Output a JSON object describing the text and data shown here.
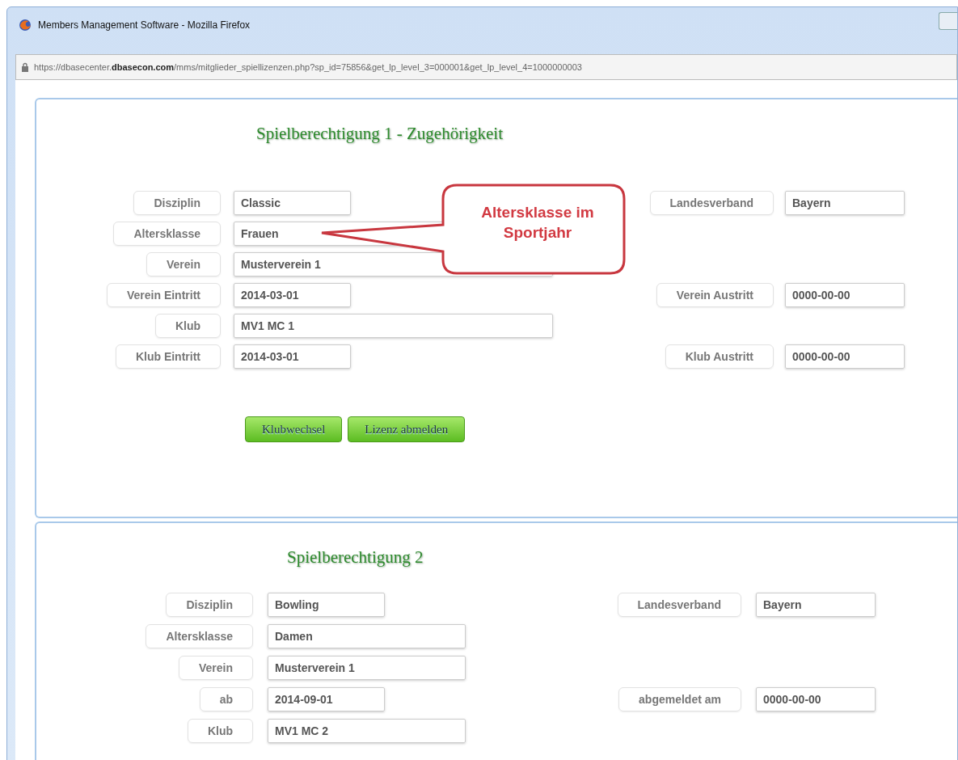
{
  "window": {
    "title": "Members Management Software - Mozilla Firefox"
  },
  "address_bar": {
    "url": "https://dbasecenter.**dbasecon.com**/mms/mitglieder_spiellizenzen.php?sp_id=75856&get_lp_level_3=000001&get_lp_level_4=1000000003"
  },
  "sections": [
    {
      "title": "Spielberechtigung 1 - Zugehörigkeit",
      "rows": [
        {
          "label": "Disziplin",
          "value": "Classic",
          "right": {
            "label": "Landesverband",
            "value": "Bayern"
          }
        },
        {
          "label": "Altersklasse",
          "value": "Frauen"
        },
        {
          "label": "Verein",
          "value": "Musterverein 1"
        },
        {
          "label": "Verein Eintritt",
          "value": "2014-03-01",
          "right": {
            "label": "Verein Austritt",
            "value": "0000-00-00"
          }
        },
        {
          "label": "Klub",
          "value": "MV1 MC 1"
        },
        {
          "label": "Klub Eintritt",
          "value": "2014-03-01",
          "right": {
            "label": "Klub Austritt",
            "value": "0000-00-00"
          }
        }
      ],
      "buttons": [
        "Klubwechsel",
        "Lizenz abmelden"
      ],
      "callout": "Altersklasse im Sportjahr"
    },
    {
      "title": "Spielberechtigung 2",
      "rows": [
        {
          "label": "Disziplin",
          "value": "Bowling",
          "right": {
            "label": "Landesverband",
            "value": "Bayern"
          }
        },
        {
          "label": "Altersklasse",
          "value": "Damen"
        },
        {
          "label": "Verein",
          "value": "Musterverein 1"
        },
        {
          "label": "ab",
          "value": "2014-09-01",
          "right": {
            "label": "abgemeldet am",
            "value": "0000-00-00"
          }
        },
        {
          "label": "Klub",
          "value": "MV1 MC 2"
        }
      ]
    }
  ]
}
